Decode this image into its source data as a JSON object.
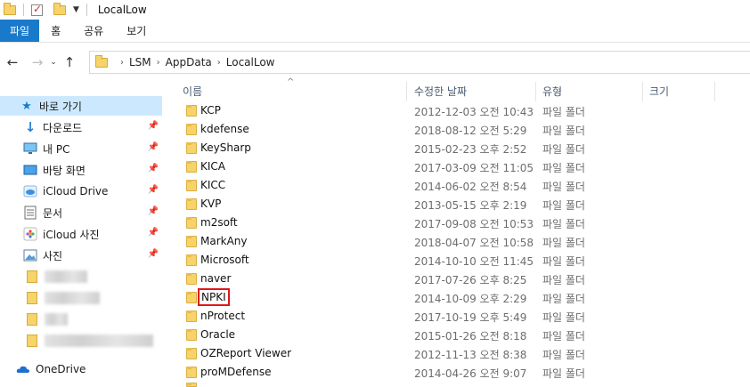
{
  "window": {
    "title": "LocalLow"
  },
  "ribbon": {
    "tabs": [
      {
        "label": "파일"
      },
      {
        "label": "홈"
      },
      {
        "label": "공유"
      },
      {
        "label": "보기"
      }
    ]
  },
  "address": {
    "crumbs": [
      "LSM",
      "AppData",
      "LocalLow"
    ]
  },
  "nav": {
    "quick_access": "바로 가기",
    "items": [
      {
        "label": "다운로드",
        "icon": "download-arrow-icon"
      },
      {
        "label": "내 PC",
        "icon": "monitor-icon"
      },
      {
        "label": "바탕 화면",
        "icon": "desktop-icon"
      },
      {
        "label": "iCloud Drive",
        "icon": "cloud-icon"
      },
      {
        "label": "문서",
        "icon": "document-icon"
      },
      {
        "label": "iCloud 사진",
        "icon": "icloud-photos-icon"
      },
      {
        "label": "사진",
        "icon": "picture-icon"
      }
    ],
    "onedrive": "OneDrive"
  },
  "columns": {
    "name": "이름",
    "modified": "수정한 날짜",
    "type": "유형",
    "size": "크기"
  },
  "files": [
    {
      "name": "KCP",
      "date": "2012-12-03 오전 10:43",
      "type": "파일 폴더"
    },
    {
      "name": "kdefense",
      "date": "2018-08-12 오전 5:29",
      "type": "파일 폴더"
    },
    {
      "name": "KeySharp",
      "date": "2015-02-23 오후 2:52",
      "type": "파일 폴더"
    },
    {
      "name": "KICA",
      "date": "2017-03-09 오전 11:05",
      "type": "파일 폴더"
    },
    {
      "name": "KICC",
      "date": "2014-06-02 오전 8:54",
      "type": "파일 폴더"
    },
    {
      "name": "KVP",
      "date": "2013-05-15 오후 2:19",
      "type": "파일 폴더"
    },
    {
      "name": "m2soft",
      "date": "2017-09-08 오전 10:53",
      "type": "파일 폴더"
    },
    {
      "name": "MarkAny",
      "date": "2018-04-07 오전 10:58",
      "type": "파일 폴더"
    },
    {
      "name": "Microsoft",
      "date": "2014-10-10 오전 11:45",
      "type": "파일 폴더"
    },
    {
      "name": "naver",
      "date": "2017-07-26 오후 8:25",
      "type": "파일 폴더"
    },
    {
      "name": "NPKI",
      "date": "2014-10-09 오후 2:29",
      "type": "파일 폴더"
    },
    {
      "name": "nProtect",
      "date": "2017-10-19 오후 5:49",
      "type": "파일 폴더"
    },
    {
      "name": "Oracle",
      "date": "2015-01-26 오전 8:18",
      "type": "파일 폴더"
    },
    {
      "name": "OZReport Viewer",
      "date": "2012-11-13 오전 8:38",
      "type": "파일 폴더"
    },
    {
      "name": "proMDefense",
      "date": "2014-04-26 오전 9:07",
      "type": "파일 폴더"
    }
  ],
  "colors": {
    "accent": "#1979ca",
    "selection": "#cce8ff",
    "highlight_box": "#e0161b",
    "folder": "#f6d36b"
  }
}
